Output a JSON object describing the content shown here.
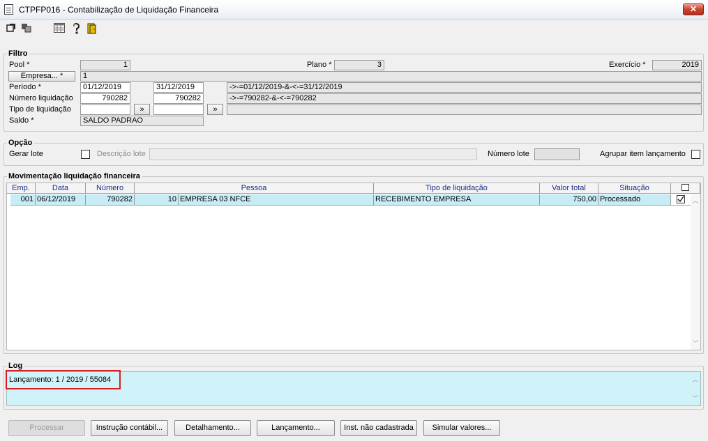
{
  "window": {
    "title": "CTPFP016 - Contabilização de Liquidação Financeira",
    "close_label": "✕"
  },
  "toolbar": {
    "icons": [
      "export-icon",
      "copy-icon",
      "calendar-grid-icon",
      "help-icon",
      "exit-door-icon"
    ]
  },
  "filtro": {
    "title": "Filtro",
    "pool_label": "Pool *",
    "pool_value": "1",
    "plano_label": "Plano *",
    "plano_value": "3",
    "exercicio_label": "Exercício *",
    "exercicio_value": "2019",
    "empresa_button": "Empresa... *",
    "empresa_value": "1",
    "periodo_label": "Período *",
    "periodo_from": "01/12/2019",
    "periodo_to": "31/12/2019",
    "periodo_expr": "->-=01/12/2019-&-<-=31/12/2019",
    "numero_label": "Número liquidação",
    "numero_from": "790282",
    "numero_to": "790282",
    "numero_expr": "->-=790282-&-<-=790282",
    "tipo_label": "Tipo de liquidação",
    "tipo_from": "",
    "tipo_to": "",
    "tipo_expr": "",
    "arrow_label": "»",
    "saldo_label": "Saldo *",
    "saldo_value": "SALDO PADRAO"
  },
  "opcao": {
    "title": "Opção",
    "gerar_lote_label": "Gerar lote",
    "gerar_lote_checked": false,
    "descricao_lote_label": "Descrição lote",
    "descricao_lote_value": "",
    "numero_lote_label": "Número lote",
    "numero_lote_value": "",
    "agrupar_label": "Agrupar item lançamento",
    "agrupar_checked": false
  },
  "movimentacao": {
    "title": "Movimentação liquidação financeira",
    "columns": [
      "Emp.",
      "Data",
      "Número",
      "Pessoa",
      "Tipo de liquidação",
      "Valor total",
      "Situação"
    ],
    "rows": [
      {
        "emp": "001",
        "data": "06/12/2019",
        "numero": "790282",
        "pessoa_codigo": "10",
        "pessoa_nome": "EMPRESA 03 NFCE",
        "tipo": "RECEBIMENTO EMPRESA",
        "valor": "750,00",
        "situacao": "Processado",
        "selected": true
      }
    ]
  },
  "log": {
    "title": "Log",
    "text": "Lançamento: 1 / 2019 / 55084"
  },
  "buttons": {
    "processar": "Processar",
    "instrucao": "Instrução contábil...",
    "detalhamento": "Detalhamento...",
    "lancamento": "Lançamento...",
    "inst_nao_cadastrada": "Inst. não cadastrada",
    "simular": "Simular valores..."
  },
  "colors": {
    "row_highlight": "#c8ecf6",
    "log_background": "#cff3f9",
    "header_text": "#1c2d8a",
    "highlight_border": "#d42020"
  }
}
